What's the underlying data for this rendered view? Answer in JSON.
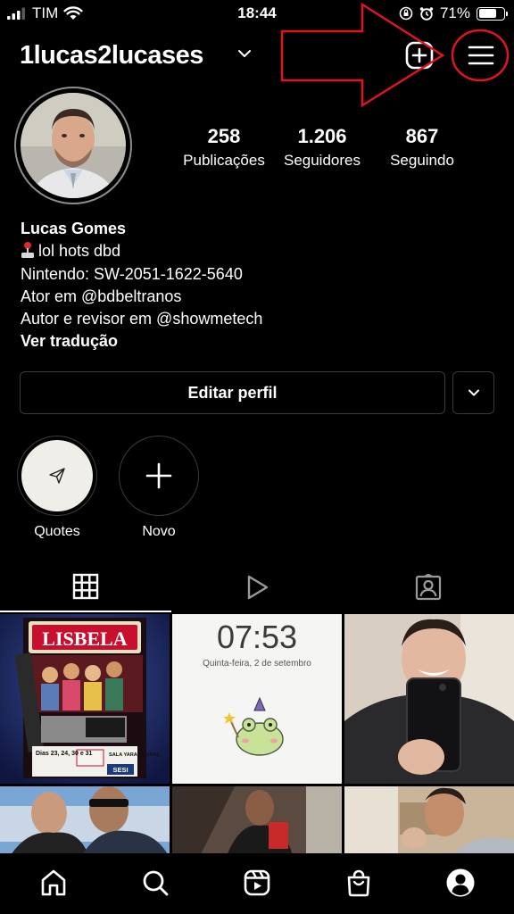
{
  "status_bar": {
    "carrier": "TIM",
    "time": "18:44",
    "battery": "71%",
    "battery_level": 0.71
  },
  "header": {
    "username": "1lucas2lucases"
  },
  "profile": {
    "stats": [
      {
        "value": "258",
        "label": "Publicações"
      },
      {
        "value": "1.206",
        "label": "Seguidores"
      },
      {
        "value": "867",
        "label": "Seguindo"
      }
    ],
    "name": "Lucas Gomes",
    "bio_lines": [
      "lol hots dbd",
      "Nintendo: SW-2051-1622-5640",
      "Ator em @bdbeltranos",
      "Autor e revisor em @showmetech"
    ],
    "translate": "Ver tradução",
    "edit_label": "Editar perfil"
  },
  "highlights": [
    {
      "label": "Quotes"
    },
    {
      "label": "Novo"
    }
  ],
  "grid": {
    "poster": {
      "title": "LISBELA",
      "dates": "Dias 23, 24, 30 e 31",
      "venue_1": "SALA YARA AMARAL",
      "venue_2": "SESI"
    },
    "lock_screen": {
      "time": "07:53",
      "date": "Quinta-feira, 2 de setembro"
    }
  },
  "colors": {
    "background": "#000000",
    "annotation": "#e0141e",
    "border": "#3a3a3a"
  }
}
